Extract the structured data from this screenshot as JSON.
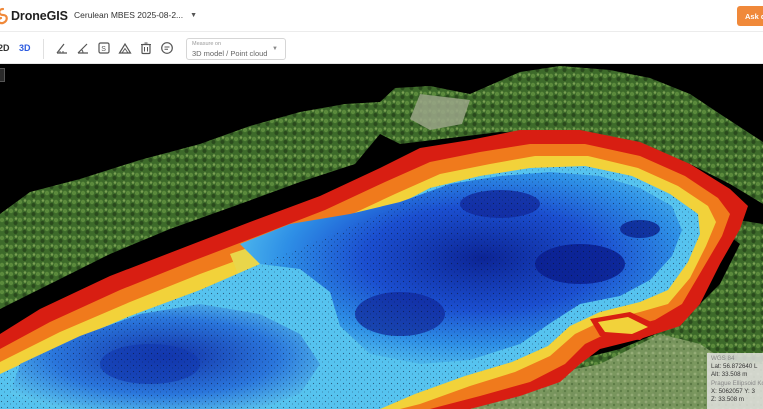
{
  "header": {
    "logo_text": "DroneGIS",
    "project_name": "Cerulean MBES 2025-08-2...",
    "ask_button_label": "Ask q"
  },
  "toolbar": {
    "view_2d": "2D",
    "view_3d": "3D",
    "active_view": "3D",
    "measure": {
      "label": "Measure on",
      "value": "3D model / Point cloud"
    },
    "tools": [
      "distance-icon",
      "angle-icon",
      "area-icon",
      "volume-icon",
      "delete-icon",
      "comment-icon"
    ]
  },
  "viewer": {
    "corner_button_label": "‹"
  },
  "info_panel": {
    "title": "WGS 84",
    "lat": "Lat: 56.872640   L",
    "alt": "Alt: 33.508 m",
    "projection_label": "Prague Ellipsoid Ko",
    "xy": "X: 5062057   Y: 3",
    "z": "Z: 33.508 m"
  },
  "colors": {
    "accent": "#2c5be0",
    "ask_button": "#f0893a",
    "depth_shallow": "#d81e12",
    "depth_mid": "#f2d23a",
    "depth_deep": "#0a1f8f",
    "vegetation": "#3f6b2a"
  }
}
